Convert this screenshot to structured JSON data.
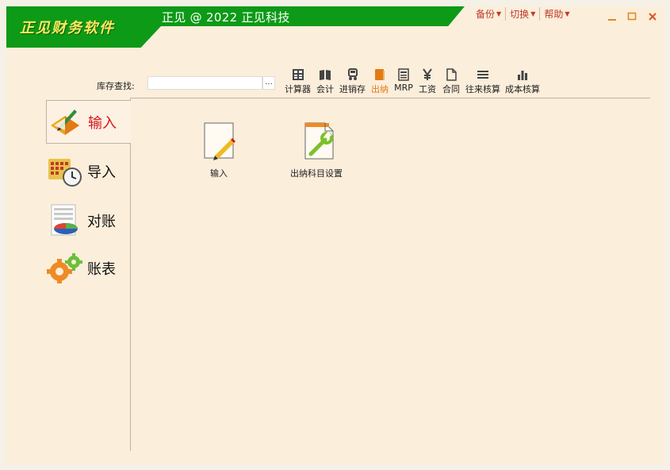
{
  "header": {
    "logo_text": "正见财务软件",
    "title": "正见 @ 2022 正见科技",
    "menu": [
      {
        "label": "备份"
      },
      {
        "label": "切换"
      },
      {
        "label": "帮助"
      }
    ]
  },
  "search": {
    "label": "库存查找:",
    "value": "",
    "button": "..."
  },
  "toolbar": {
    "items": [
      {
        "label": "计算器",
        "icon": "calculator-icon"
      },
      {
        "label": "会计",
        "icon": "book-icon"
      },
      {
        "label": "进销存",
        "icon": "cart-icon"
      },
      {
        "label": "出纳",
        "icon": "cashier-icon",
        "active": true
      },
      {
        "label": "MRP",
        "icon": "mrp-icon"
      },
      {
        "label": "工资",
        "icon": "yen-icon"
      },
      {
        "label": "合同",
        "icon": "document-icon"
      },
      {
        "label": "往来核算",
        "icon": "lines-icon"
      },
      {
        "label": "成本核算",
        "icon": "bar-chart-icon"
      }
    ]
  },
  "sidebar": {
    "items": [
      {
        "label": "输入",
        "icon": "pen-book-icon",
        "active": true
      },
      {
        "label": "导入",
        "icon": "calendar-clock-icon"
      },
      {
        "label": "对账",
        "icon": "pie-chart-icon"
      },
      {
        "label": "账表",
        "icon": "gears-icon"
      }
    ]
  },
  "content": {
    "items": [
      {
        "label": "输入",
        "icon": "pencil-page-icon"
      },
      {
        "label": "出纳科目设置",
        "icon": "wrench-page-icon"
      }
    ]
  },
  "colors": {
    "accent": "#0d9a17",
    "logo": "#ffe95c",
    "active": "#e07b16",
    "menu": "#c0392b"
  }
}
